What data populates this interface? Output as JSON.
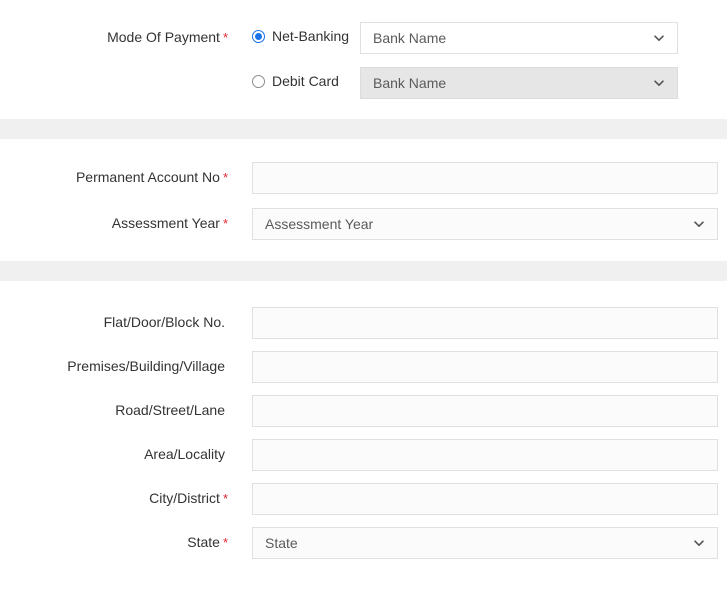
{
  "payment": {
    "label": "Mode Of Payment",
    "required_marker": "*",
    "options": [
      {
        "id": "net-banking",
        "label": "Net-Banking",
        "selected": true,
        "dropdown_value": "Bank Name",
        "dropdown_disabled": false
      },
      {
        "id": "debit-card",
        "label": "Debit Card",
        "selected": false,
        "dropdown_value": "Bank Name",
        "dropdown_disabled": true
      }
    ]
  },
  "taxpayer": {
    "fields": [
      {
        "label": "Permanent Account No",
        "required_marker": "*",
        "type": "text",
        "value": "",
        "placeholder": ""
      },
      {
        "label": "Assessment Year",
        "required_marker": "*",
        "type": "select",
        "value": "Assessment Year"
      }
    ]
  },
  "address": {
    "fields": [
      {
        "label": "Flat/Door/Block No.",
        "required_marker": "",
        "type": "text",
        "value": "",
        "placeholder": ""
      },
      {
        "label": "Premises/Building/Village",
        "required_marker": "",
        "type": "text",
        "value": "",
        "placeholder": ""
      },
      {
        "label": "Road/Street/Lane",
        "required_marker": "",
        "type": "text",
        "value": "",
        "placeholder": ""
      },
      {
        "label": "Area/Locality",
        "required_marker": "",
        "type": "text",
        "value": "",
        "placeholder": ""
      },
      {
        "label": "City/District",
        "required_marker": "*",
        "type": "text",
        "value": "",
        "placeholder": ""
      },
      {
        "label": "State",
        "required_marker": "*",
        "type": "select",
        "value": "State"
      }
    ]
  },
  "icons": {
    "dropdown": "chevron-down-icon"
  },
  "colors": {
    "required_asterisk": "#e1262d",
    "radio_selected": "#1a73e8",
    "band": "#f0f0f0",
    "field_border": "#dfe0e1",
    "field_background": "#fbfbfb",
    "disabled_background": "#e6e6e6"
  }
}
